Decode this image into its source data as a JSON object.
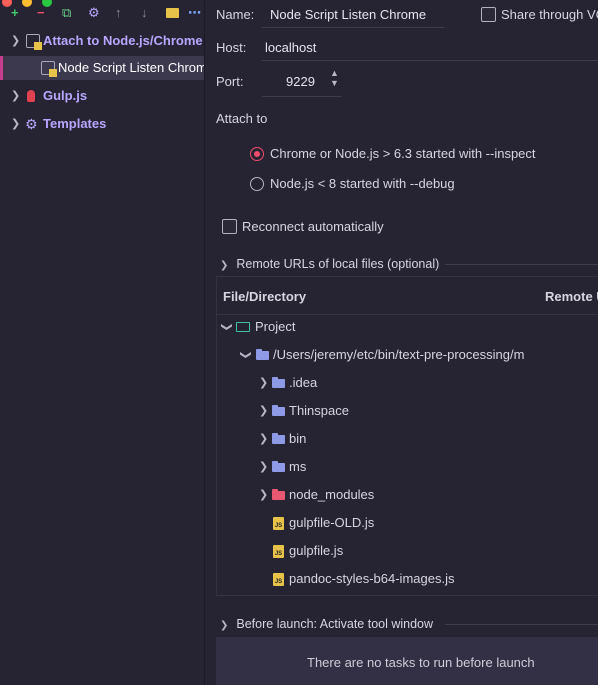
{
  "toolbar": {
    "add": "+",
    "remove": "−",
    "copy": "⧉",
    "settings": "⚙",
    "up": "↑",
    "down": "↓",
    "folder": "📁",
    "more": "⋯"
  },
  "tree": {
    "items": [
      {
        "label": "Attach to Node.js/Chrome"
      },
      {
        "label": "Node Script Listen Chrome"
      },
      {
        "label": "Gulp.js"
      },
      {
        "label": "Templates"
      }
    ]
  },
  "form": {
    "name_label": "Name:",
    "name_value": "Node Script Listen Chrome",
    "share_label": "Share through VCS",
    "host_label": "Host:",
    "host_value": "localhost",
    "port_label": "Port:",
    "port_value": "9229",
    "attach_to_label": "Attach to",
    "radio_options": [
      {
        "label": "Chrome or Node.js > 6.3 started with --inspect",
        "selected": true
      },
      {
        "label": "Node.js < 8 started with --debug",
        "selected": false
      }
    ],
    "reconnect_label": "Reconnect automatically",
    "reconnect_checked": false
  },
  "remote_urls": {
    "title": "Remote URLs of local files (optional)",
    "columns": [
      "File/Directory",
      "Remote URL"
    ],
    "rows": [
      {
        "label": "Project"
      },
      {
        "label": "/Users/jeremy/etc/bin/text-pre-processing/m"
      },
      {
        "label": ".idea"
      },
      {
        "label": "Thinspace"
      },
      {
        "label": "bin"
      },
      {
        "label": "ms"
      },
      {
        "label": "node_modules"
      },
      {
        "label": "gulpfile-OLD.js"
      },
      {
        "label": "gulpfile.js"
      },
      {
        "label": "pandoc-styles-b64-images.js"
      }
    ]
  },
  "before_launch": {
    "title": "Before launch: Activate tool window",
    "empty_text": "There are no tasks to run before launch"
  },
  "colors": {
    "accent": "#b9a6ff",
    "selected_radio": "#ef4b6b",
    "background": "#262432"
  }
}
